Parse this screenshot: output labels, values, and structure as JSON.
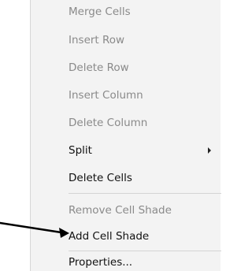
{
  "context_menu": {
    "items": [
      {
        "label": "Merge Cells",
        "enabled": false
      },
      {
        "label": "Insert Row",
        "enabled": false
      },
      {
        "label": "Delete Row",
        "enabled": false
      },
      {
        "label": "Insert Column",
        "enabled": false
      },
      {
        "label": "Delete Column",
        "enabled": false
      },
      {
        "label": "Split",
        "enabled": true,
        "has_submenu": true
      },
      {
        "label": "Delete Cells",
        "enabled": true
      },
      {
        "label": "Remove Cell Shade",
        "enabled": false
      },
      {
        "label": "Add Cell Shade",
        "enabled": true
      },
      {
        "label": "Properties...",
        "enabled": true
      }
    ]
  },
  "colors": {
    "menu_background": "#f3f3f3",
    "disabled_text": "#8a8a8a",
    "enabled_text": "#111111",
    "separator": "#d4d4d4",
    "arrow": "#000000"
  }
}
